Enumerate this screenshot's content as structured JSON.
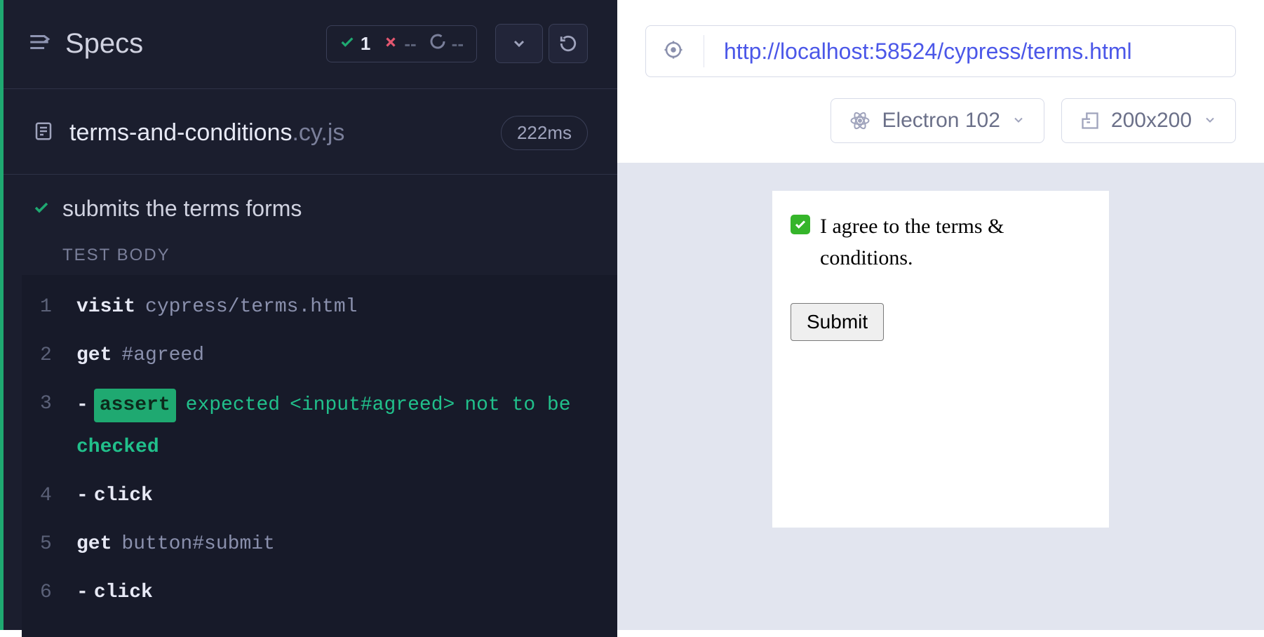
{
  "header": {
    "title": "Specs",
    "passed_count": "1",
    "failed_count": "--",
    "pending_count": "--"
  },
  "spec": {
    "file_base": "terms-and-conditions",
    "file_ext": ".cy.js",
    "duration": "222ms"
  },
  "test": {
    "title": "submits the terms forms",
    "body_label": "TEST BODY"
  },
  "commands": [
    {
      "num": "1",
      "parts": [
        {
          "cls": "tok-name",
          "text": "visit"
        },
        {
          "cls": "tok-arg",
          "text": "cypress/terms.html"
        }
      ]
    },
    {
      "num": "2",
      "parts": [
        {
          "cls": "tok-name",
          "text": "get"
        },
        {
          "cls": "tok-arg",
          "text": "#agreed"
        }
      ]
    },
    {
      "num": "3",
      "parts": [
        {
          "cls": "tok-dash",
          "text": "-"
        },
        {
          "cls": "tok-assert",
          "text": "assert"
        },
        {
          "cls": "tok-assert-kw",
          "text": "expected"
        },
        {
          "cls": "tok-assert-subj",
          "text": "<input#agreed>"
        },
        {
          "cls": "tok-assert-plain",
          "text": "not to be"
        },
        {
          "cls": "tok-assert-val",
          "text": "checked"
        }
      ]
    },
    {
      "num": "4",
      "parts": [
        {
          "cls": "tok-dash",
          "text": "-"
        },
        {
          "cls": "tok-name",
          "text": "click"
        }
      ]
    },
    {
      "num": "5",
      "parts": [
        {
          "cls": "tok-name",
          "text": "get"
        },
        {
          "cls": "tok-arg",
          "text": "button#submit"
        }
      ]
    },
    {
      "num": "6",
      "parts": [
        {
          "cls": "tok-dash",
          "text": "-"
        },
        {
          "cls": "tok-name",
          "text": "click"
        }
      ]
    }
  ],
  "aut": {
    "url": "http://localhost:58524/cypress/terms.html",
    "browser": "Electron 102",
    "viewport": "200x200",
    "terms_label": "I agree to the terms & conditions.",
    "submit_label": "Submit",
    "checkbox_checked": true
  }
}
